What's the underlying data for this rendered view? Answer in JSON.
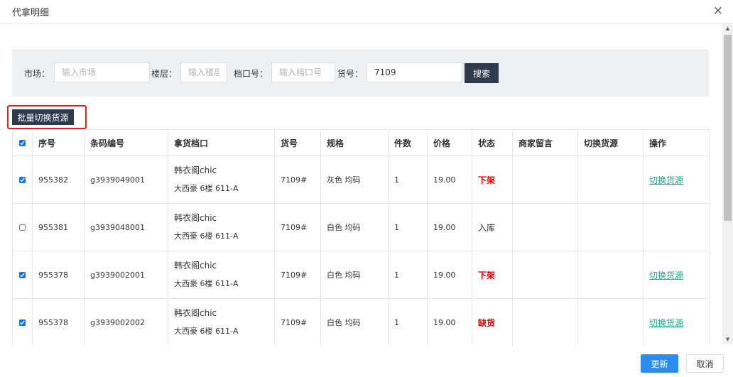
{
  "dialog": {
    "title": "代拿明细",
    "close_icon": "×"
  },
  "search": {
    "market_label": "市场：",
    "market_placeholder": "输入市场",
    "market_value": "",
    "floor_label": "楼层：",
    "floor_placeholder": "输入楼层",
    "floor_value": "",
    "stall_label": "档口号：",
    "stall_placeholder": "输入档口号",
    "stall_value": "",
    "item_label": "货号：",
    "item_placeholder": "",
    "item_value": "7109",
    "search_button": "搜索"
  },
  "batch_button": "批量切换货源",
  "table": {
    "headers": [
      "序号",
      "条码编号",
      "拿货档口",
      "货号",
      "规格",
      "件数",
      "价格",
      "状态",
      "商家留言",
      "切换货源",
      "操作"
    ],
    "header_checked": true,
    "rows": [
      {
        "checked": true,
        "seq": "955382",
        "barcode": "g3939049001",
        "stall_name": "韩衣阁chic",
        "stall_addr": "大西豪 6楼 611-A",
        "item_no": "7109#",
        "spec": "灰色 均码",
        "qty": "1",
        "price": "19.00",
        "status": "下架",
        "status_color": "#e00000",
        "message": "",
        "switch_source": "",
        "action": "切换货源"
      },
      {
        "checked": false,
        "seq": "955381",
        "barcode": "g3939048001",
        "stall_name": "韩衣阁chic",
        "stall_addr": "大西豪 6楼 611-A",
        "item_no": "7109#",
        "spec": "白色 均码",
        "qty": "1",
        "price": "19.00",
        "status": "入库",
        "status_color": "#333333",
        "message": "",
        "switch_source": "",
        "action": ""
      },
      {
        "checked": true,
        "seq": "955378",
        "barcode": "g3939002001",
        "stall_name": "韩衣阁chic",
        "stall_addr": "大西豪 6楼 611-A",
        "item_no": "7109#",
        "spec": "白色 均码",
        "qty": "1",
        "price": "19.00",
        "status": "下架",
        "status_color": "#e00000",
        "message": "",
        "switch_source": "",
        "action": "切换货源"
      },
      {
        "checked": true,
        "seq": "955378",
        "barcode": "g3939002002",
        "stall_name": "韩衣阁chic",
        "stall_addr": "大西豪 6楼 611-A",
        "item_no": "7109#",
        "spec": "白色 均码",
        "qty": "1",
        "price": "19.00",
        "status": "缺货",
        "status_color": "#e00000",
        "message": "",
        "switch_source": "",
        "action": "切换货源"
      }
    ]
  },
  "footer": {
    "update_button": "更新",
    "cancel_button": "取消"
  },
  "colors": {
    "primary": "#2d8cf0",
    "dark_button": "#2e3b4e",
    "link": "#1fa587",
    "status_red": "#e00000",
    "highlight_frame": "#e02020"
  }
}
